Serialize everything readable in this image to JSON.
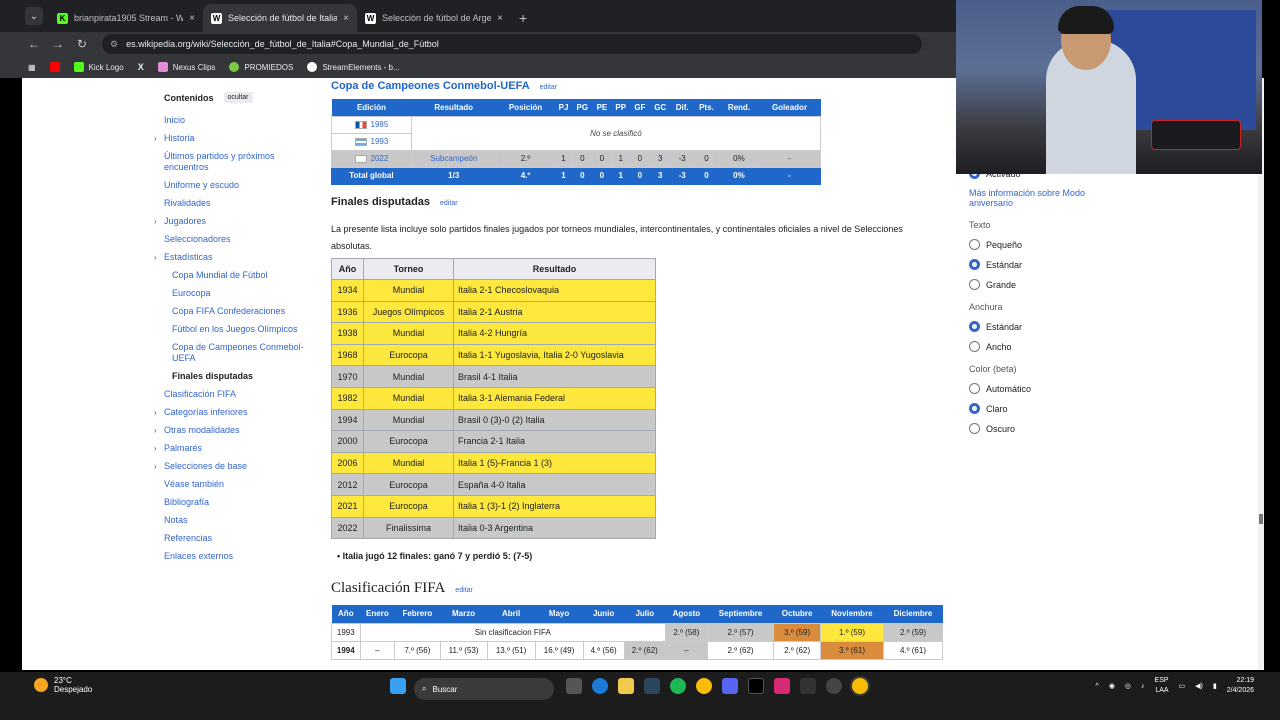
{
  "browser": {
    "tabs": [
      {
        "title": "brianpirata1905 Stream - Watch",
        "favicon": "kick-icon",
        "active": false
      },
      {
        "title": "Selección de fútbol de Italia - W",
        "favicon": "wikipedia-icon",
        "active": true
      },
      {
        "title": "Selección de fútbol de Argentin",
        "favicon": "wikipedia-icon",
        "active": false
      }
    ],
    "url": "es.wikipedia.org/wiki/Selección_de_fútbol_de_Italia#Copa_Mundial_de_Fútbol",
    "bookmarks": [
      "Kick Logo",
      "Nexus Clips",
      "PROMIEDOS",
      "StreamElements - b..."
    ]
  },
  "toc": {
    "title": "Contenidos",
    "hide_label": "ocultar",
    "items": [
      {
        "label": "Inicio",
        "chev": false,
        "sub": false
      },
      {
        "label": "Historia",
        "chev": true,
        "sub": false
      },
      {
        "label": "Últimos partidos y próximos encuentros",
        "chev": false,
        "sub": false
      },
      {
        "label": "Uniforme y escudo",
        "chev": false,
        "sub": false
      },
      {
        "label": "Rivalidades",
        "chev": false,
        "sub": false
      },
      {
        "label": "Jugadores",
        "chev": true,
        "sub": false
      },
      {
        "label": "Seleccionadores",
        "chev": false,
        "sub": false
      },
      {
        "label": "Estadísticas",
        "chev": true,
        "sub": false
      },
      {
        "label": "Copa Mundial de Fútbol",
        "chev": false,
        "sub": true
      },
      {
        "label": "Eurocopa",
        "chev": false,
        "sub": true
      },
      {
        "label": "Copa FIFA Confederaciones",
        "chev": false,
        "sub": true
      },
      {
        "label": "Fútbol en los Juegos Olímpicos",
        "chev": false,
        "sub": true
      },
      {
        "label": "Copa de Campeones Conmebol-UEFA",
        "chev": false,
        "sub": true
      },
      {
        "label": "Finales disputadas",
        "chev": false,
        "sub": true,
        "current": true
      },
      {
        "label": "Clasificación FIFA",
        "chev": false,
        "sub": false
      },
      {
        "label": "Categorías inferiores",
        "chev": true,
        "sub": false
      },
      {
        "label": "Otras modalidades",
        "chev": true,
        "sub": false
      },
      {
        "label": "Palmarés",
        "chev": true,
        "sub": false
      },
      {
        "label": "Selecciones de base",
        "chev": true,
        "sub": false
      },
      {
        "label": "Véase también",
        "chev": false,
        "sub": false
      },
      {
        "label": "Bibliografía",
        "chev": false,
        "sub": false
      },
      {
        "label": "Notas",
        "chev": false,
        "sub": false
      },
      {
        "label": "Referencias",
        "chev": false,
        "sub": false
      },
      {
        "label": "Enlaces externos",
        "chev": false,
        "sub": false
      }
    ]
  },
  "copa": {
    "heading": "Copa de Campeones Conmebol-UEFA",
    "edit": "editar",
    "headers": [
      "Edición",
      "Resultado",
      "Posición",
      "PJ",
      "PG",
      "PE",
      "PP",
      "GF",
      "GC",
      "Dif.",
      "Pts.",
      "Rend.",
      "Goleador"
    ],
    "no_class": "No se clasificó",
    "rows": [
      {
        "year": "1985",
        "flag": "france"
      },
      {
        "year": "1993",
        "flag": "argentina"
      }
    ],
    "row2022": [
      "2022",
      "Subcampeón",
      "2.º",
      "1",
      "0",
      "0",
      "1",
      "0",
      "3",
      "-3",
      "0",
      "0%",
      "-"
    ],
    "total": [
      "Total global",
      "1/3",
      "4.º",
      "1",
      "0",
      "0",
      "1",
      "0",
      "3",
      "-3",
      "0",
      "0%",
      "-"
    ]
  },
  "finales": {
    "heading": "Finales disputadas",
    "edit": "editar",
    "intro": "La presente lista incluye solo partidos finales jugados por torneos mundiales, intercontinentales, y continentales oficiales a nivel de Selecciones absolutas.",
    "headers": [
      "Año",
      "Torneo",
      "Resultado"
    ],
    "rows": [
      {
        "year": "1934",
        "tournament": "Mundial",
        "result": "Italia 2-1 Checoslovaquia",
        "won": true
      },
      {
        "year": "1936",
        "tournament": "Juegos Olímpicos",
        "result": "Italia 2-1 Austria",
        "won": true
      },
      {
        "year": "1938",
        "tournament": "Mundial",
        "result": "Italia 4-2 Hungría",
        "won": true
      },
      {
        "year": "1968",
        "tournament": "Eurocopa",
        "result": "Italia 1-1 Yugoslavia, Italia 2-0 Yugoslavia",
        "won": true
      },
      {
        "year": "1970",
        "tournament": "Mundial",
        "result": "Brasil 4-1 Italia",
        "won": false
      },
      {
        "year": "1982",
        "tournament": "Mundial",
        "result": "Italia 3-1 Alemania Federal",
        "won": true
      },
      {
        "year": "1994",
        "tournament": "Mundial",
        "result": "Brasil 0 (3)-0 (2) Italia",
        "won": false
      },
      {
        "year": "2000",
        "tournament": "Eurocopa",
        "result": "Francia 2-1 Italia",
        "won": false
      },
      {
        "year": "2006",
        "tournament": "Mundial",
        "result": "Italia 1 (5)-Francia 1 (3)",
        "won": true
      },
      {
        "year": "2012",
        "tournament": "Eurocopa",
        "result": "España 4-0 Italia",
        "won": false
      },
      {
        "year": "2021",
        "tournament": "Eurocopa",
        "result": "Italia 1 (3)-1 (2) Inglaterra",
        "won": true
      },
      {
        "year": "2022",
        "tournament": "Finalissima",
        "result": "Italia 0-3 Argentina",
        "won": false
      }
    ],
    "summary": "Italia jugó 12 finales: ganó 7 y perdió 5: (7-5)"
  },
  "fifa": {
    "heading": "Clasificación FIFA",
    "edit": "editar",
    "headers": [
      "Año",
      "Enero",
      "Febrero",
      "Marzo",
      "Abril",
      "Mayo",
      "Junio",
      "Julio",
      "Agosto",
      "Septiembre",
      "Octubre",
      "Noviembre",
      "Diciembre"
    ],
    "row1993": {
      "year": "1993",
      "note": "Sin clasificacion FIFA",
      "values": [
        "2.º (58)",
        "2.º (57)",
        "3.º (59)",
        "1.º (59)",
        "2.º (59)"
      ]
    },
    "row1994": [
      "1994",
      "–",
      "7.º (56)",
      "11.º (53)",
      "13.º (51)",
      "16.º (49)",
      "4.º (56)",
      "2.º (62)",
      "–",
      "2.º (62)",
      "2.º (62)",
      "3.º (61)",
      "4.º (61)"
    ]
  },
  "appearance": {
    "activado": "Activado",
    "more_info": "Más información sobre Modo aniversario",
    "groups": [
      {
        "title": "Texto",
        "options": [
          "Pequeño",
          "Estándar",
          "Grande"
        ],
        "selected": 1
      },
      {
        "title": "Anchura",
        "options": [
          "Estándar",
          "Ancho"
        ],
        "selected": 0
      },
      {
        "title": "Color (beta)",
        "options": [
          "Automático",
          "Claro",
          "Oscuro"
        ],
        "selected": 1
      }
    ]
  },
  "taskbar": {
    "temp": "23°C",
    "weather": "Despejado",
    "search": "Buscar",
    "lang1": "ESP",
    "lang2": "LAA",
    "time": "22:19",
    "date": "2/4/2026"
  }
}
